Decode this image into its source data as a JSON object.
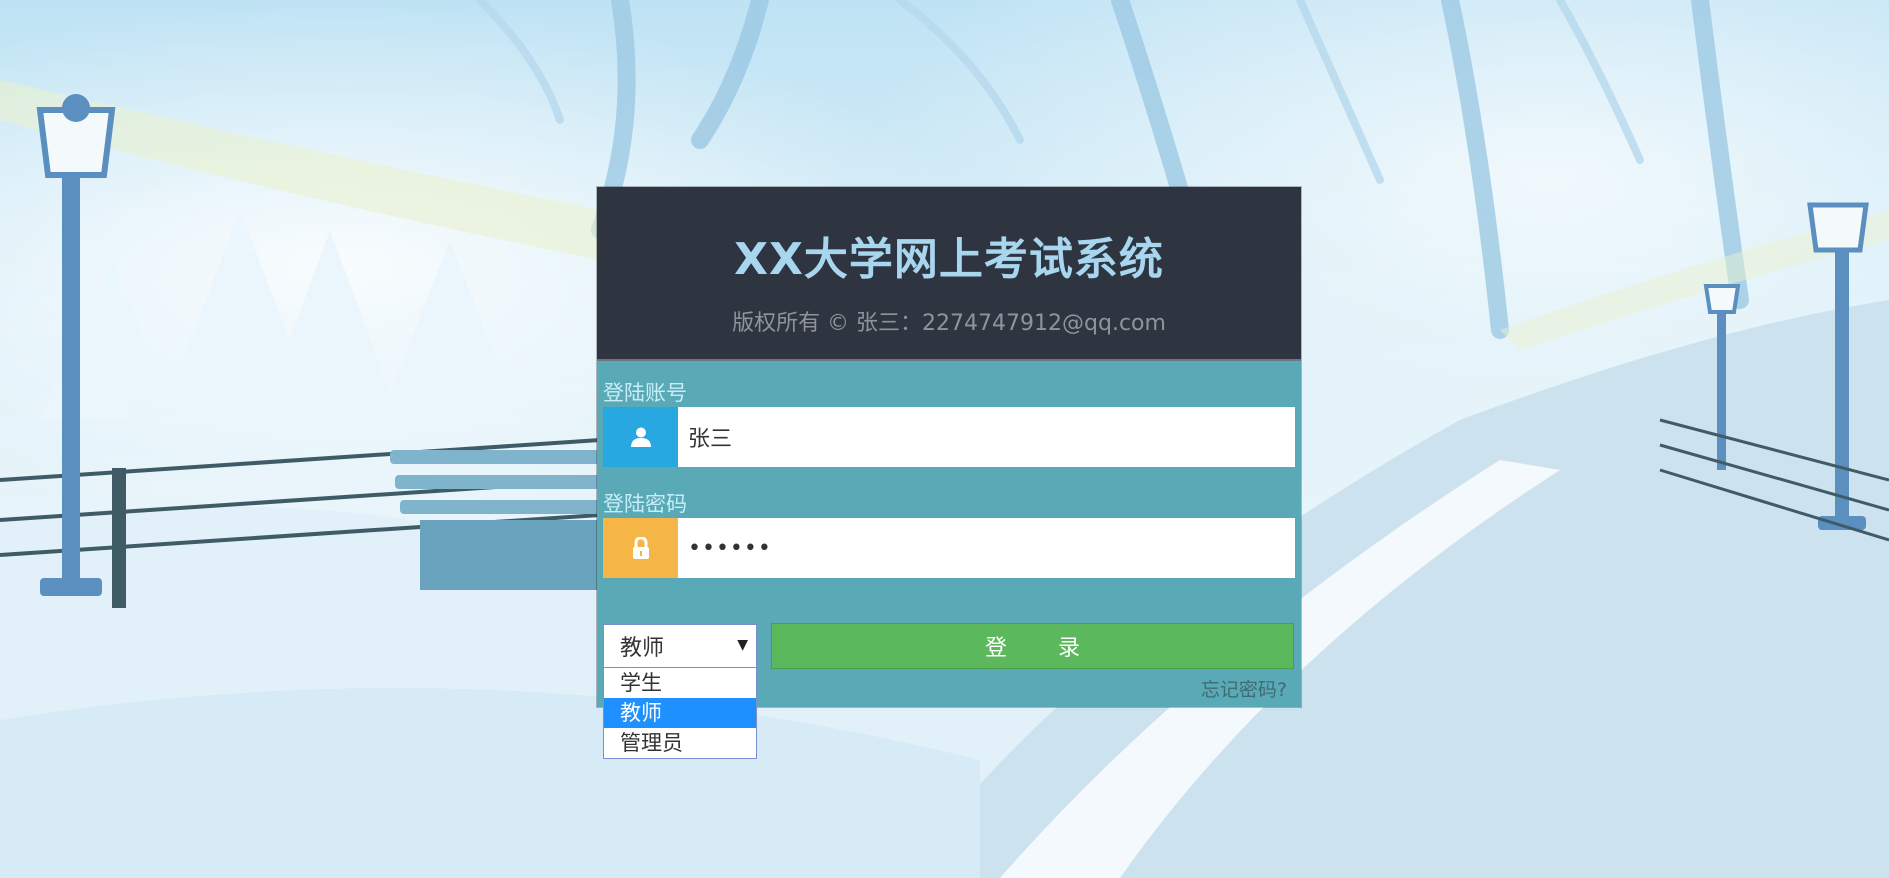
{
  "header": {
    "title": "XX大学网上考试系统",
    "copyright": "版权所有 © 张三：2274747912@qq.com"
  },
  "account": {
    "label": "登陆账号",
    "value": "张三",
    "icon": "user-icon"
  },
  "password": {
    "label": "登陆密码",
    "value": "••••••",
    "icon": "lock-icon"
  },
  "role_select": {
    "selected": "教师",
    "options": [
      "学生",
      "教师",
      "管理员"
    ]
  },
  "login_button": {
    "label": "登 录"
  },
  "forgot_password": {
    "label": "忘记密码?"
  },
  "colors": {
    "header_bg": "#2e3540",
    "panel_bg": "#5aa9b6",
    "title": "#a7d6ee",
    "user_icon_bg": "#27a8e0",
    "lock_icon_bg": "#f5b547",
    "login_button_bg": "#5cb85c",
    "option_highlight": "#1e90ff"
  }
}
